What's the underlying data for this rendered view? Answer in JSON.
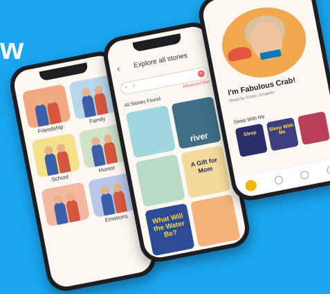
{
  "brand": {
    "fragment": "w"
  },
  "phone_categories": {
    "categories": [
      {
        "label": "Friendship",
        "color": "#f2a97f"
      },
      {
        "label": "Family",
        "color": "#b8d7ec"
      },
      {
        "label": "School",
        "color": "#f5e08a"
      },
      {
        "label": "Humor",
        "color": "#cfe3c8"
      },
      {
        "label": "",
        "color": "#f2b8a0"
      },
      {
        "label": "Emotions",
        "color": "#b9c8e9"
      }
    ]
  },
  "phone_explore": {
    "title": "Explore all stories",
    "search_value": "s",
    "advanced_search": "Advanced filter",
    "results": "All Stories Found",
    "books": [
      {
        "title": "",
        "color": "#9fd6e0",
        "style": ""
      },
      {
        "title": "river",
        "color": "#3f6e86",
        "style": ""
      },
      {
        "title": "",
        "color": "#b7dbc4",
        "style": ""
      },
      {
        "title": "A Gift for Mom",
        "color": "#f3d99b",
        "style": "dark"
      },
      {
        "title": "What Will the Water Be?",
        "color": "#2e4b96",
        "style": "yellow"
      },
      {
        "title": "",
        "color": "#f4b27a",
        "style": ""
      }
    ]
  },
  "phone_story": {
    "title": "I'm Fabulous Crab!",
    "subtitle": "Read by Kristin Schaefer",
    "section": "Sleep With Me",
    "recommendations": [
      {
        "label": "Sleep",
        "color": "#2a2e6b"
      },
      {
        "label": "Sleep With Me",
        "color": "#3d3f7e"
      },
      {
        "label": "",
        "color": "#b8405a"
      }
    ]
  }
}
